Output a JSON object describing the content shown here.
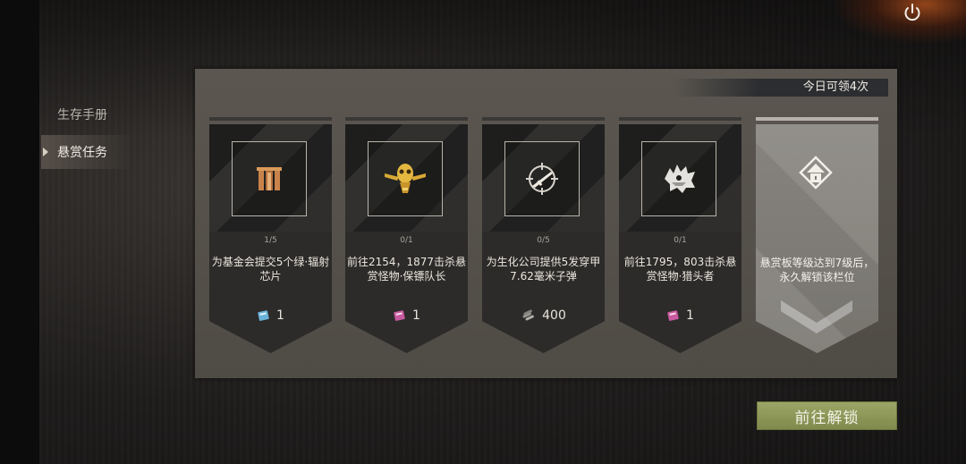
{
  "sidebar": {
    "items": [
      {
        "label": "生存手册"
      },
      {
        "label": "悬赏任务"
      }
    ]
  },
  "panel": {
    "daily_limit": "今日可领4次"
  },
  "cards": [
    {
      "icon": "gate-icon",
      "progress": "1/5",
      "desc": "为基金会提交5个绿·辐射芯片",
      "reward_icon": "ticket-blue-icon",
      "reward_amount": "1"
    },
    {
      "icon": "gold-skull-emblem-icon",
      "progress": "0/1",
      "desc": "前往2154，1877击杀悬赏怪物·保镖队长",
      "reward_icon": "ticket-pink-icon",
      "reward_amount": "1"
    },
    {
      "icon": "rifle-crosshair-icon",
      "progress": "0/5",
      "desc": "为生化公司提供5发穿甲7.62毫米子弹",
      "reward_icon": "bullets-icon",
      "reward_amount": "400"
    },
    {
      "icon": "monster-head-icon",
      "progress": "0/1",
      "desc": "前往1795，803击杀悬赏怪物·猎头者",
      "reward_icon": "ticket-pink-icon",
      "reward_amount": "1"
    },
    {
      "icon": "lock-icon",
      "desc": "悬赏板等级达到7级后，永久解锁该栏位"
    }
  ],
  "actions": {
    "unlock_label": "前往解锁"
  },
  "colors": {
    "accent_button": "#8c9758",
    "panel": "#56524c"
  }
}
